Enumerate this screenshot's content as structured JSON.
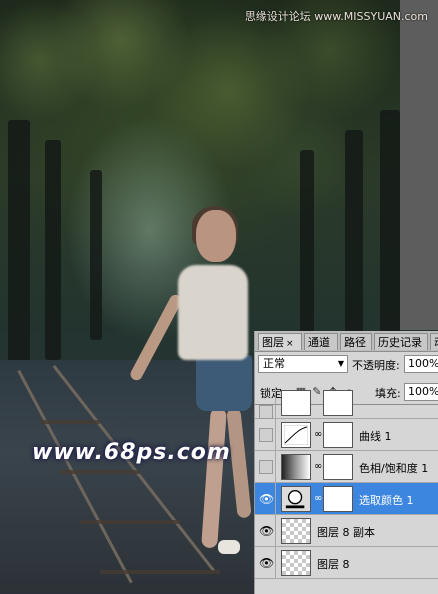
{
  "watermark": {
    "top_text": "思缘设计论坛 www.MISSYUAN.com",
    "bottom_text": "www.68ps.com"
  },
  "layers_panel": {
    "tabs": [
      {
        "label": "图层",
        "close": "×",
        "active": true
      },
      {
        "label": "通道",
        "active": false
      },
      {
        "label": "路径",
        "active": false
      },
      {
        "label": "历史记录",
        "active": false
      },
      {
        "label": "动",
        "active": false
      }
    ],
    "blend_mode": "正常",
    "opacity_label": "不透明度:",
    "opacity_value": "100%",
    "lock_label": "锁定:",
    "lock_icons": [
      "transparent-pixels-lock-icon",
      "brush-lock-icon",
      "move-lock-icon",
      "padlock-icon"
    ],
    "fill_label": "填充:",
    "fill_value": "100%",
    "layers": [
      {
        "name": "",
        "type": "adjustment",
        "visible": false,
        "selected": false,
        "partial": true
      },
      {
        "name": "曲线 1",
        "type": "curves",
        "visible": false,
        "selected": false
      },
      {
        "name": "色相/饱和度 1",
        "type": "hue-saturation",
        "visible": false,
        "selected": false
      },
      {
        "name": "选取颜色 1",
        "type": "selective-color",
        "visible": true,
        "selected": true
      },
      {
        "name": "图层 8 副本",
        "type": "pixel",
        "visible": true,
        "selected": false
      },
      {
        "name": "图层 8",
        "type": "pixel",
        "visible": true,
        "selected": false
      }
    ]
  }
}
